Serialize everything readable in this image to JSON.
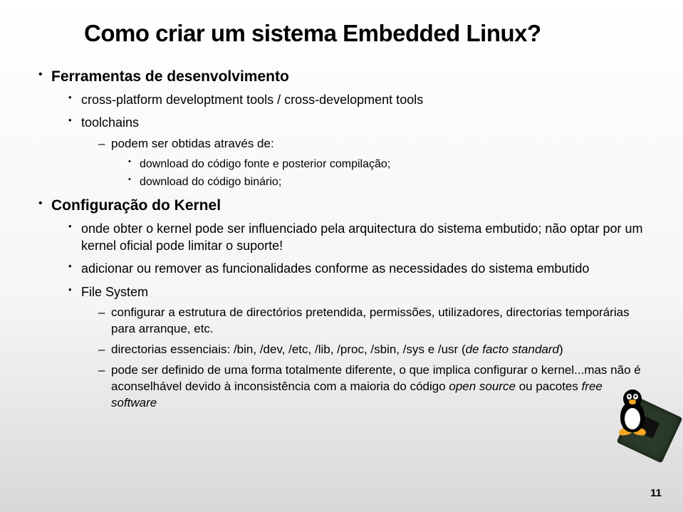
{
  "title": "Como criar um sistema Embedded Linux?",
  "page_number": "11",
  "b1": {
    "label": "Ferramentas de desenvolvimento",
    "items": [
      "cross-platform developtment tools / cross-development tools",
      "toolchains"
    ],
    "toolchains_sub_label": "podem ser obtidas através de:",
    "toolchains_pts": [
      "download do código fonte e posterior compilação;",
      "download do código binário;"
    ]
  },
  "b2": {
    "label": "Configuração do Kernel",
    "pt1": "onde obter o kernel pode ser influenciado pela arquitectura do sistema embutido; não optar por um kernel oficial pode limitar o suporte!",
    "pt2": "adicionar ou remover as funcionalidades conforme as necessidades do sistema embutido",
    "fs_label": "File System",
    "fs1": "configurar a estrutura de directórios pretendida, permissões, utilizadores, directorias temporárias para arranque, etc.",
    "fs2_a": "directorias essenciais: /bin, /dev, /etc, /lib, /proc, /sbin, /sys e /usr (",
    "fs2_b": "de facto standard",
    "fs2_c": ")",
    "fs3_a": "pode ser definido de uma forma totalmente diferente, o que implica configurar o kernel...mas não é aconselhável devido à inconsistência com a maioria do código ",
    "fs3_b": "open source",
    "fs3_c": " ou pacotes ",
    "fs3_d": "free software"
  }
}
